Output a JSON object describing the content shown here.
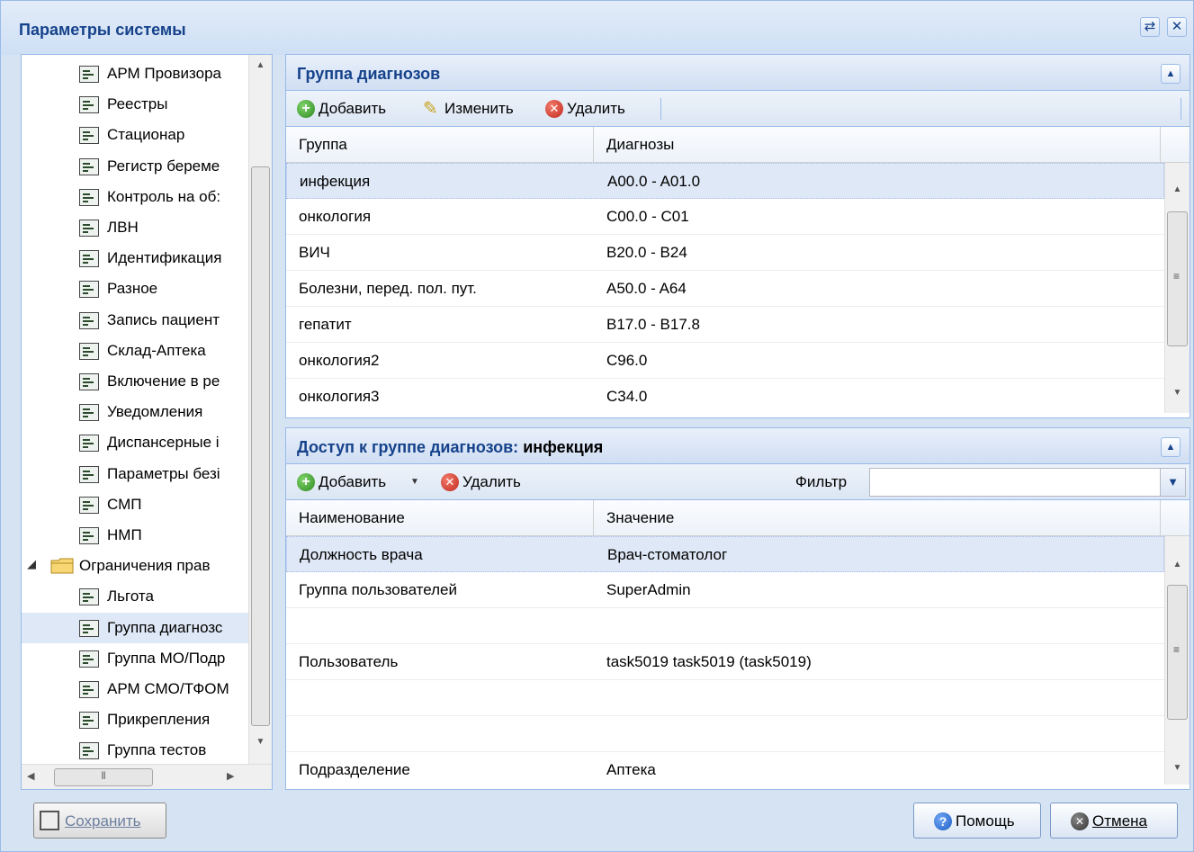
{
  "window": {
    "title": "Параметры системы"
  },
  "tree": {
    "items": [
      {
        "label": "АРМ Провизора",
        "type": "leaf"
      },
      {
        "label": "Реестры",
        "type": "leaf"
      },
      {
        "label": "Стационар",
        "type": "leaf"
      },
      {
        "label": "Регистр береме",
        "type": "leaf"
      },
      {
        "label": "Контроль на об:",
        "type": "leaf"
      },
      {
        "label": "ЛВН",
        "type": "leaf"
      },
      {
        "label": "Идентификация",
        "type": "leaf"
      },
      {
        "label": "Разное",
        "type": "leaf"
      },
      {
        "label": "Запись пациент",
        "type": "leaf"
      },
      {
        "label": "Склад-Аптека",
        "type": "leaf"
      },
      {
        "label": "Включение в ре",
        "type": "leaf"
      },
      {
        "label": "Уведомления",
        "type": "leaf"
      },
      {
        "label": "Диспансерные і",
        "type": "leaf"
      },
      {
        "label": "Параметры безі",
        "type": "leaf"
      },
      {
        "label": "СМП",
        "type": "leaf"
      },
      {
        "label": "НМП",
        "type": "leaf"
      },
      {
        "label": "Ограничения прав",
        "type": "folder"
      },
      {
        "label": "Льгота",
        "type": "leaf"
      },
      {
        "label": "Группа диагнозс",
        "type": "leaf",
        "selected": true
      },
      {
        "label": "Группа МО/Подр",
        "type": "leaf"
      },
      {
        "label": "АРМ СМО/ТФОМ",
        "type": "leaf"
      },
      {
        "label": "Прикрепления",
        "type": "leaf"
      },
      {
        "label": "Группа тестов",
        "type": "leaf"
      }
    ]
  },
  "diagnosis_group_panel": {
    "title": "Группа диагнозов",
    "toolbar": {
      "add": "Добавить",
      "edit": "Изменить",
      "delete": "Удалить"
    },
    "columns": [
      "Группа",
      "Диагнозы"
    ],
    "rows": [
      {
        "group": "инфекция",
        "diagnoses": "A00.0 - A01.0",
        "selected": true
      },
      {
        "group": "онкология",
        "diagnoses": "C00.0 - C01"
      },
      {
        "group": "ВИЧ",
        "diagnoses": "B20.0 - B24"
      },
      {
        "group": "Болезни, перед. пол. пут.",
        "diagnoses": "A50.0 - A64"
      },
      {
        "group": "гепатит",
        "diagnoses": "B17.0 - B17.8"
      },
      {
        "group": "онкология2",
        "diagnoses": "C96.0"
      },
      {
        "group": "онкология3",
        "diagnoses": "C34.0"
      }
    ]
  },
  "access_panel": {
    "title_prefix": "Доступ к группе диагнозов:",
    "title_group": "инфекция",
    "toolbar": {
      "add": "Добавить",
      "delete": "Удалить",
      "filter_label": "Фильтр",
      "filter_value": ""
    },
    "columns": [
      "Наименование",
      "Значение"
    ],
    "rows": [
      {
        "name": "Должность врача",
        "value": "Врач-стоматолог",
        "selected": true
      },
      {
        "name": "Группа пользователей",
        "value": "SuperAdmin"
      },
      {
        "name": "",
        "value": ""
      },
      {
        "name": "Пользователь",
        "value": "task5019 task5019 (task5019)"
      },
      {
        "name": "",
        "value": ""
      },
      {
        "name": "",
        "value": ""
      },
      {
        "name": "Подразделение",
        "value": "Аптека"
      }
    ]
  },
  "footer": {
    "save": "Сохранить",
    "help": "Помощь",
    "cancel": "Отмена"
  },
  "colors": {
    "header_text": "#15428b",
    "border": "#99bbe8",
    "selection": "#dfe8f6"
  }
}
